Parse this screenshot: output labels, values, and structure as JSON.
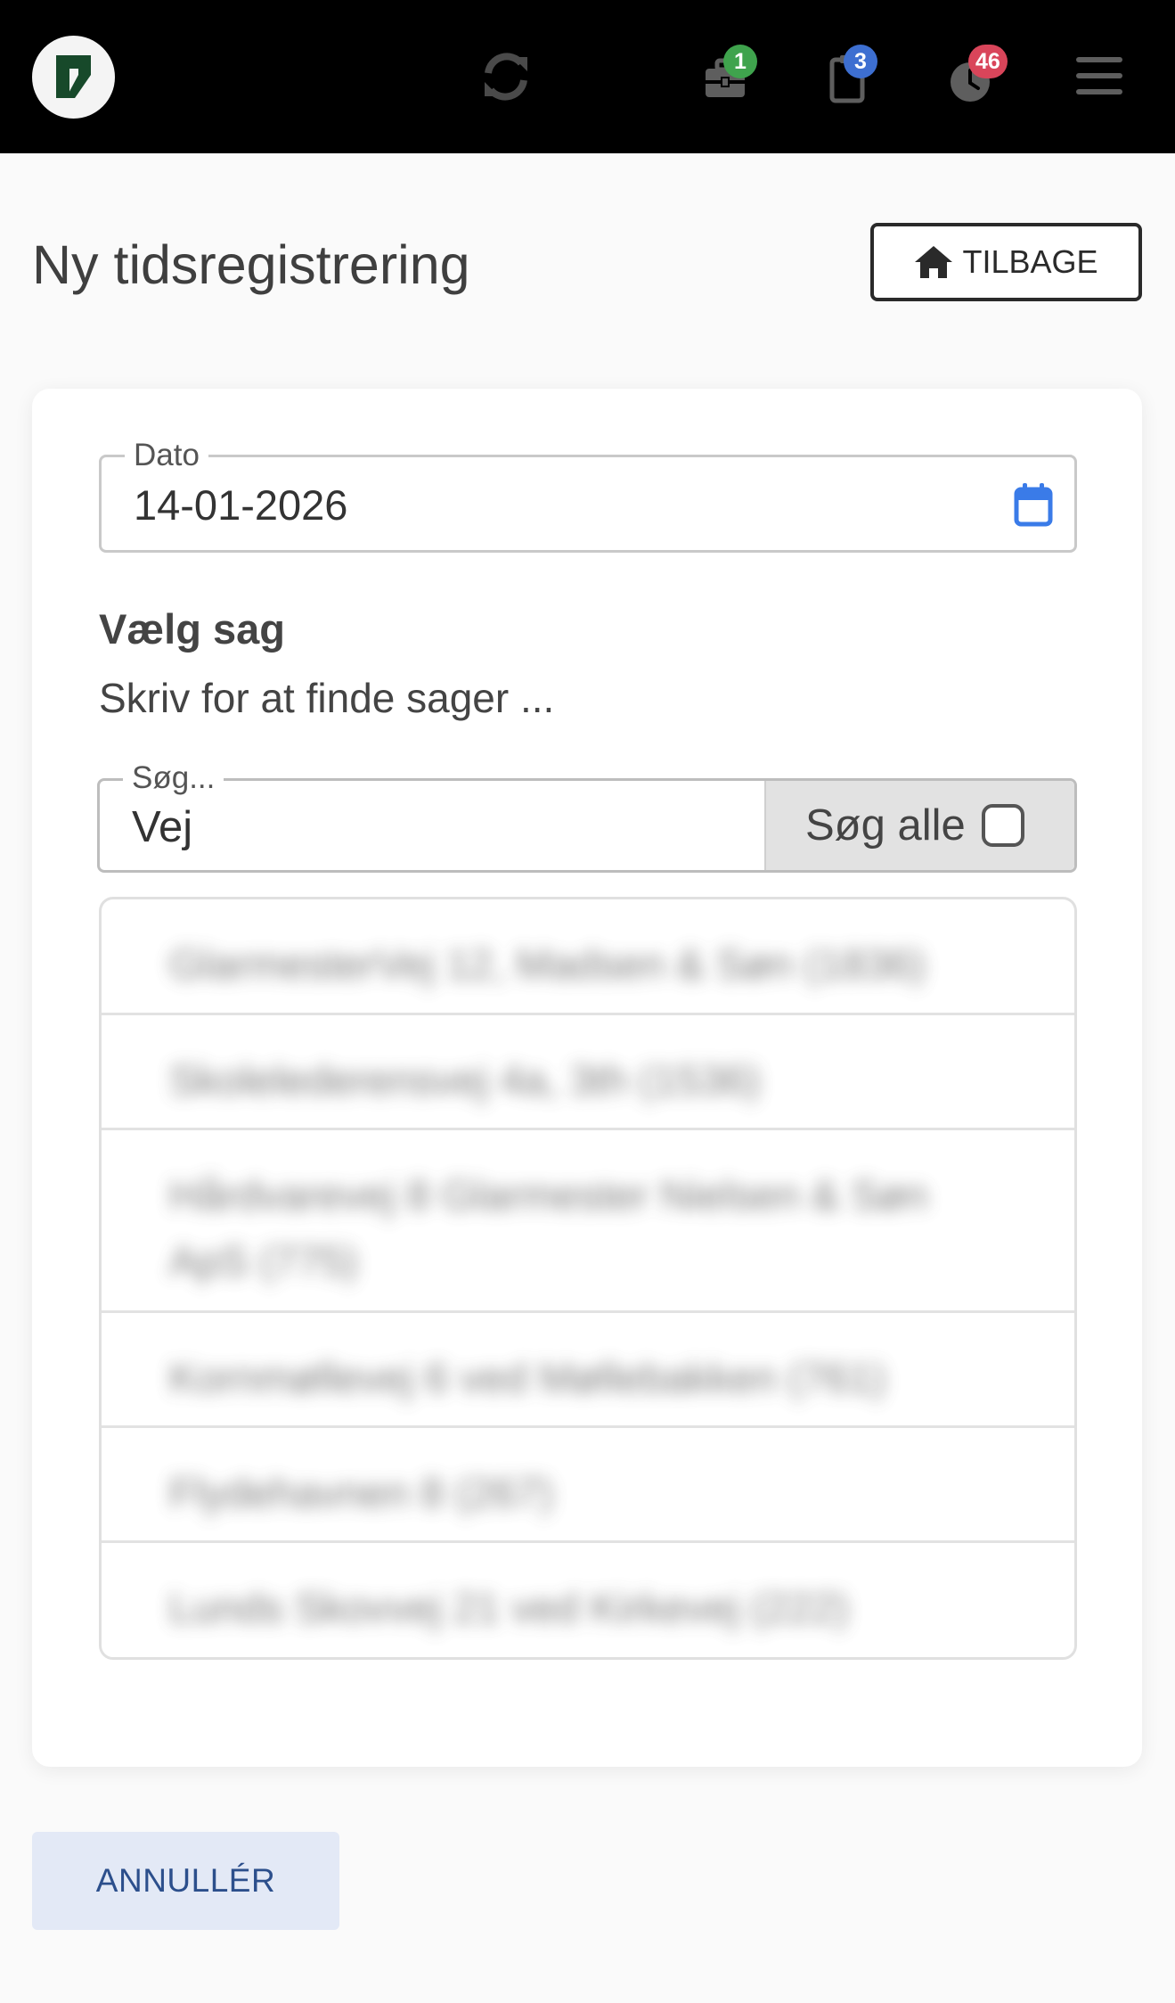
{
  "nav": {
    "icons": [
      "logo-icon",
      "sync-icon",
      "toolbox-icon",
      "clipboard-icon",
      "clock-icon",
      "hamburger-menu-icon"
    ],
    "badges": {
      "jobs": "1",
      "tasks": "3",
      "time": "46"
    },
    "badge_colors": {
      "jobs": "#3fa34d",
      "tasks": "#3d6fd1",
      "time": "#d9455a"
    }
  },
  "page": {
    "title": "Ny tidsregistrering",
    "back_label": "TILBAGE"
  },
  "date_field": {
    "label": "Dato",
    "value": "14-01-2026"
  },
  "case_section": {
    "heading": "Vælg sag",
    "hint": "Skriv for at finde sager ..."
  },
  "search": {
    "label": "Søg...",
    "value": "Vej",
    "search_all_label": "Søg alle"
  },
  "results": [
    "Glarmester­Vej 12, Madsen & Søn (1836)",
    "Skolelederens­vej 4a, 3th (1536)",
    "Hårdvare­vej 8 Glarmester Nielsen & Søn ApS (775)",
    "Kornmøllevej 6 ved Møllebakken (761)",
    "Flydehavnen 8 (267)",
    "Lunds Skovvej 21 ved Kirkevej (222)"
  ],
  "footer": {
    "cancel_label": "ANNULLÉR"
  },
  "colors": {
    "accent": "#2c4f8c",
    "calendar_icon": "#3a7be8",
    "topbar": "#000000"
  }
}
